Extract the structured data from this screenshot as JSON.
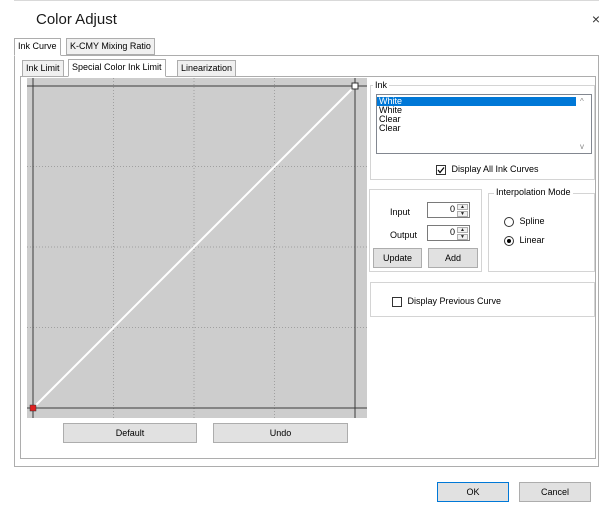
{
  "window": {
    "title": "Color Adjust",
    "close_symbol": "×"
  },
  "tabs_main": [
    "Ink Curve",
    "K-CMY Mixing Ratio"
  ],
  "tabs_sub": [
    "Ink Limit",
    "Special Color Ink Limit",
    "Linearization"
  ],
  "chart_data": {
    "type": "line",
    "series": [
      {
        "name": "White",
        "points": [
          [
            0,
            0
          ],
          [
            255,
            255
          ]
        ],
        "color": "#ffffff"
      }
    ],
    "xlim": [
      0,
      255
    ],
    "ylim": [
      0,
      255
    ],
    "grid": true,
    "grid_divisions": 4,
    "point_markers": [
      {
        "x": 0,
        "y": 0,
        "color": "#e02020",
        "style": "filled"
      },
      {
        "x": 255,
        "y": 255,
        "color": "#ffffff",
        "style": "hollow"
      }
    ],
    "title": "",
    "xlabel": "",
    "ylabel": ""
  },
  "buttons": {
    "default": "Default",
    "undo": "Undo",
    "update": "Update",
    "add": "Add",
    "ok": "OK",
    "cancel": "Cancel"
  },
  "ink": {
    "label": "Ink",
    "items": [
      "White",
      "White",
      "Clear",
      "Clear"
    ],
    "selected_index": 0,
    "display_all_label": "Display All Ink Curves",
    "display_all_checked": true
  },
  "io": {
    "input_label": "Input",
    "input_value": "0",
    "output_label": "Output",
    "output_value": "0"
  },
  "interp": {
    "label": "Interpolation Mode",
    "spline_label": "Spline",
    "linear_label": "Linear",
    "selected": "Linear"
  },
  "prev_curve": {
    "label": "Display Previous Curve",
    "checked": false
  }
}
